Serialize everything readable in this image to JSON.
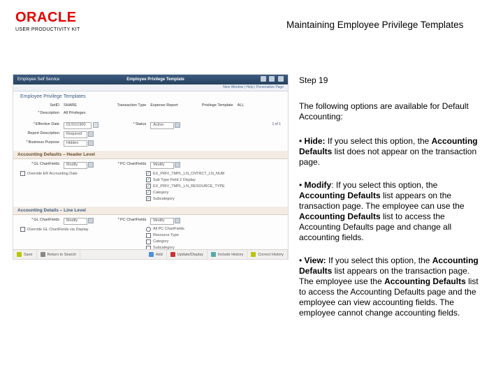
{
  "logo": {
    "brand": "ORACLE",
    "product": "USER PRODUCTIVITY KIT"
  },
  "doc_title": "Maintaining Employee Privilege Templates",
  "side": {
    "step": "Step 19",
    "intro": "The following options are available for Default Accounting:",
    "bullets": [
      {
        "lead": "• ",
        "bold": "Hide:",
        "rest": " If you select this option, the ",
        "bold2": "Accounting Defaults",
        "rest2": " list does not appear on the transaction page."
      },
      {
        "lead": "• ",
        "bold": "Modify",
        "rest": ": If you select this option, the ",
        "bold2": "Accounting Defaults",
        "rest2": " list appears on the transaction page. The employee can use the ",
        "bold3": "Accounting Defaults",
        "rest3": " list to access the Accounting Defaults page and change all accounting fields."
      },
      {
        "lead": "• ",
        "bold": "View:",
        "rest": " If you select this option, the ",
        "bold2": "Accounting Defaults",
        "rest2": " list appears on the transaction page. The employee use the ",
        "bold3": "Accounting Defaults",
        "rest3": " list  to access the Accounting Defaults page and the employee can view accounting fields. The employee cannot change accounting fields."
      }
    ]
  },
  "ss": {
    "svc_label": "Employee Self Service",
    "page_heading": "Employee Privilege Template",
    "sublinks": "New Window | Help | Personalize Page",
    "page_title": "Employee Privilege Templates",
    "row1": {
      "k1": "SetID",
      "v1": "SHARE",
      "k2": "Transaction Type",
      "v2": "Expense Report",
      "k3": "Privilege Template",
      "v3": "ALL"
    },
    "row2": {
      "k1": "Description",
      "v1": "All Privileges"
    },
    "line1": {
      "k1": "Effective Date",
      "v1": "01/01/1900",
      "k2": "Status",
      "v2": "Active",
      "seq": "1 of 1"
    },
    "line2": {
      "k1": "Report Description",
      "v1": "Required"
    },
    "line3": {
      "k1": "Business Purpose",
      "v1": "Hidden"
    },
    "sec1": "Accounting Defaults – Header Level",
    "al1": {
      "k1": "GL ChartFields",
      "v1": "Modify",
      "k2": "PC ChartFields",
      "v2": "Modify"
    },
    "al2": "Override ER Accounting Date",
    "al_checks": [
      "EX_PRIV_TMPL_LN_CNTRCT_LN_NUM",
      "Sub Type Field 2 Display",
      "EX_PRIV_TMPL_LN_RESOURCE_TYPE",
      "Category",
      "Subcategory"
    ],
    "sec2": "Accounting Details – Line Level",
    "bl1": {
      "k1": "GL ChartFields",
      "v1": "Modify",
      "k2": "PC ChartFields",
      "v2": "Modify"
    },
    "bl2": "Override GL ChartFields via Display",
    "bl_items": [
      {
        "t": "radio",
        "label": "All PC ChartFields"
      },
      {
        "t": "check",
        "label": "Resource Type",
        "checked": false
      },
      {
        "t": "check",
        "label": "Category",
        "checked": false
      },
      {
        "t": "check",
        "label": "Subcategory",
        "checked": false
      }
    ],
    "toolbar": [
      "Save",
      "Return to Search",
      "Add",
      "Update/Display",
      "Include History",
      "Correct History"
    ]
  }
}
